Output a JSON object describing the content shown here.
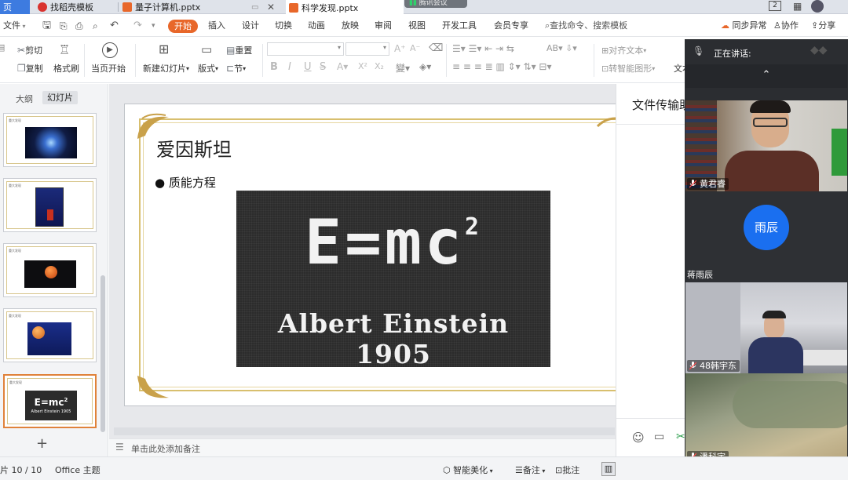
{
  "tabs": [
    {
      "label": "页"
    },
    {
      "label": "找稻壳模板"
    },
    {
      "label": "量子计算机.pptx"
    },
    {
      "label": "科学发现.pptx"
    }
  ],
  "meeting_app_label": "腾讯会议",
  "window_indicators": {
    "badge": "2"
  },
  "menu": {
    "file": "文件",
    "items": [
      "开始",
      "插入",
      "设计",
      "切换",
      "动画",
      "放映",
      "审阅",
      "视图",
      "开发工具",
      "会员专享"
    ],
    "search": "查找命令、搜索模板",
    "sync": "同步异常",
    "collab": "协作",
    "share": "分享"
  },
  "ribbon": {
    "cut": "剪切",
    "copy": "复制",
    "format_painter": "格式刷",
    "from_current": "当页开始",
    "new_slide": "新建幻灯片",
    "layout": "版式",
    "reset": "重置",
    "section": "节",
    "text_box": "文本框",
    "align_text": "对齐文本",
    "smart_shape": "转智能图形"
  },
  "left_panel": {
    "outline_tab": "大纲",
    "slides_tab": "幻灯片"
  },
  "slide": {
    "title": "爱因斯坦",
    "bullet": "● 质能方程",
    "formula": "E=mc",
    "superscript": "2",
    "caption": "Albert Einstein 1905"
  },
  "thumb_text": {
    "title": "重大发现",
    "formula": "E=mc",
    "sup": "2",
    "caption": "Albert Einstein 1905"
  },
  "notes_placeholder": "单击此处添加备注",
  "status": {
    "slide_counter": "片 10 / 10",
    "theme": "Office 主题",
    "beautify": "智能美化",
    "notes": "备注",
    "comments": "批注"
  },
  "transfer_panel": {
    "title": "文件传输助"
  },
  "meeting": {
    "speaking_label": "正在讲话:",
    "participants": [
      {
        "name": "黄君睿"
      },
      {
        "name": "蒋雨辰",
        "avatar_text": "雨辰"
      },
      {
        "name": "48韩宇东"
      },
      {
        "name": "潘科宇"
      }
    ]
  },
  "colors": {
    "accent": "#e8672a",
    "meeting_bg": "#2b2d31",
    "avatar_blue": "#1a6ff0",
    "slide_gold": "#d8bf6e"
  }
}
